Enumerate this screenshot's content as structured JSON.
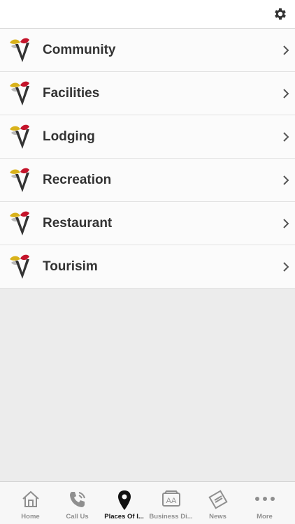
{
  "header": {
    "settings_icon": "gear-icon"
  },
  "list": {
    "items": [
      {
        "label": "Community",
        "icon": "logo-icon"
      },
      {
        "label": "Facilities",
        "icon": "logo-icon"
      },
      {
        "label": "Lodging",
        "icon": "logo-icon"
      },
      {
        "label": "Recreation",
        "icon": "logo-icon"
      },
      {
        "label": "Restaurant",
        "icon": "logo-icon"
      },
      {
        "label": "Tourisim",
        "icon": "logo-icon"
      }
    ]
  },
  "tabbar": {
    "tabs": [
      {
        "label": "Home",
        "icon": "home-icon",
        "active": false
      },
      {
        "label": "Call Us",
        "icon": "phone-icon",
        "active": false
      },
      {
        "label": "Places Of I...",
        "icon": "map-pin-icon",
        "active": true
      },
      {
        "label": "Business Di...",
        "icon": "directory-icon",
        "active": false
      },
      {
        "label": "News",
        "icon": "newspaper-icon",
        "active": false
      },
      {
        "label": "More",
        "icon": "more-icon",
        "active": false
      }
    ]
  },
  "colors": {
    "accent_active": "#111111",
    "tab_inactive": "#8f8f8f",
    "logo_yellow": "#d9b21a",
    "logo_red": "#c4142b",
    "logo_v": "#333333"
  }
}
